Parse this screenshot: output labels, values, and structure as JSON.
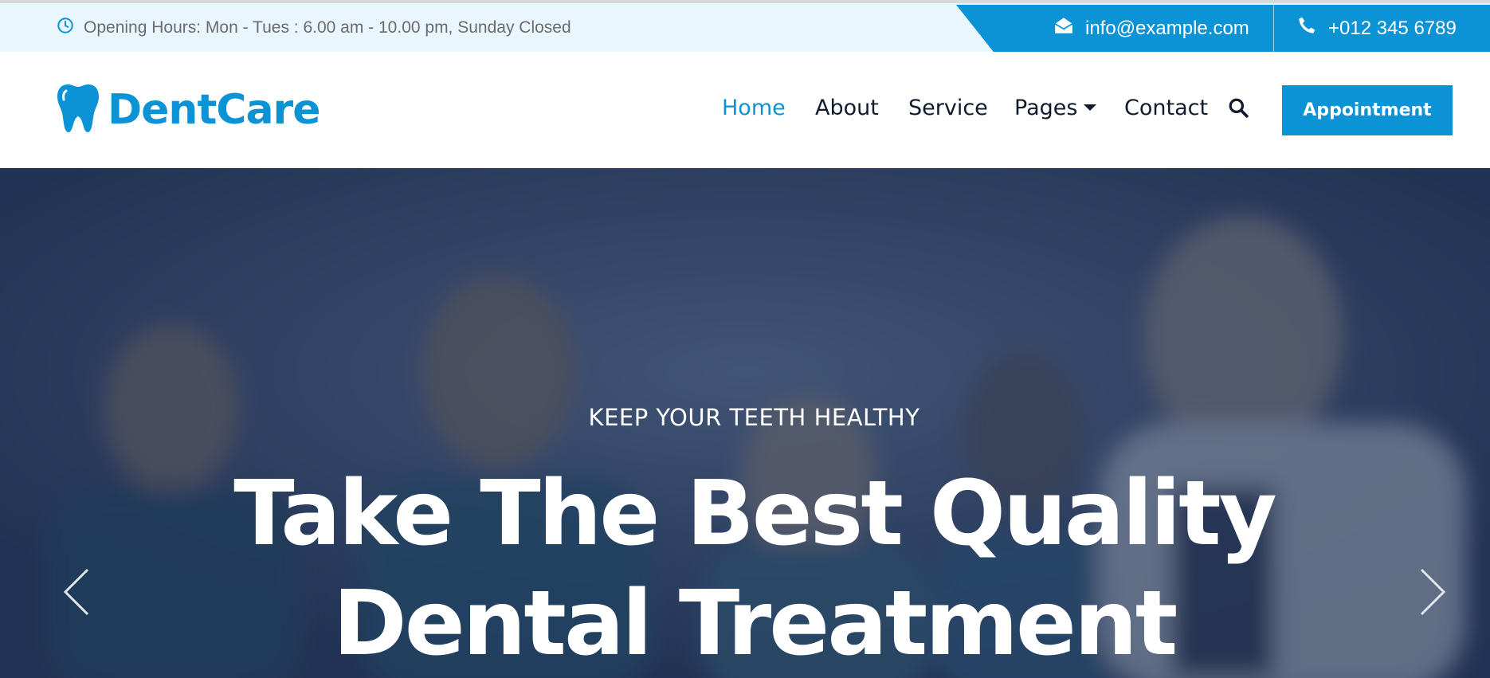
{
  "topbar": {
    "hours_text": "Opening Hours: Mon - Tues : 6.00 am - 10.00 pm, Sunday Closed",
    "email": "info@example.com",
    "phone": "+012 345 6789",
    "icons": [
      "clock-icon",
      "envelope-icon",
      "phone-icon"
    ]
  },
  "navbar": {
    "brand": "DentCare",
    "items": [
      {
        "label": "Home",
        "active": true
      },
      {
        "label": "About"
      },
      {
        "label": "Service"
      },
      {
        "label": "Pages",
        "dropdown": true
      },
      {
        "label": "Contact"
      }
    ],
    "search_icon": "search-icon",
    "appointment_label": "Appointment"
  },
  "hero": {
    "kicker": "KEEP YOUR TEETH HEALTHY",
    "title_line1": "Take The Best Quality",
    "title_line2": "Dental Treatment",
    "prev_icon": "chevron-left-icon",
    "next_icon": "chevron-right-icon"
  },
  "colors": {
    "accent": "#0b93d6",
    "topbar_bg": "#eaf6fd",
    "nav_text": "#101b2e",
    "hero_overlay": "#1c2b4c"
  }
}
